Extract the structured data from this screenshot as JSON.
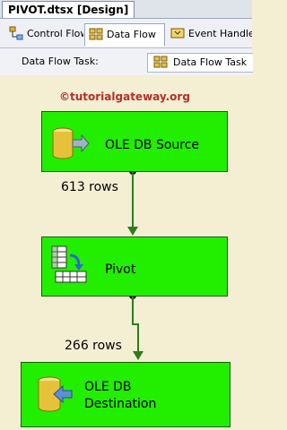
{
  "document_tab": {
    "title": "PIVOT.dtsx [Design]"
  },
  "designer_tabs": [
    {
      "label": "Control Flow",
      "icon": "control-flow-icon"
    },
    {
      "label": "Data Flow",
      "icon": "data-flow-icon"
    },
    {
      "label": "Event Handlers",
      "icon": "event-handlers-icon"
    }
  ],
  "task_bar": {
    "label": "Data Flow Task:",
    "selected_task": "Data Flow Task",
    "icon": "data-flow-task-icon"
  },
  "watermark": "©tutorialgateway.org",
  "components": {
    "source": {
      "label": "OLE DB Source",
      "icon": "database-source-icon"
    },
    "pivot": {
      "label": "Pivot",
      "icon": "pivot-transform-icon"
    },
    "destination": {
      "label_line1": "OLE DB",
      "label_line2": "Destination",
      "icon": "database-destination-icon"
    }
  },
  "paths": [
    {
      "label": "613 rows"
    },
    {
      "label": "266 rows"
    }
  ],
  "colors": {
    "component_fill": "#22ee00",
    "canvas": "#f4eed3",
    "connector": "#2e7d1a",
    "watermark": "#b3302b"
  }
}
